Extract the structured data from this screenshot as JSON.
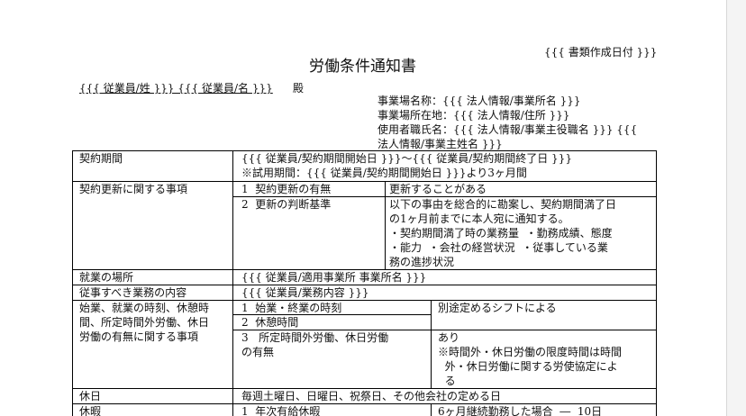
{
  "header": {
    "date": "{{{ 書類作成日付 }}}",
    "title": "労働条件通知書",
    "employee_name": "{{{ 従業員/姓 }}}  {{{ 従業員/名 }}}",
    "honorific": "殿",
    "workplace_name": "事業場名称：{{{ 法人情報/事業所名 }}}",
    "workplace_address": "事業場所在地：{{{ 法人情報/住所  }}}",
    "employer_line1": "使用者職氏名：{{{ 法人情報/事業主役職名 }}} {{{",
    "employer_line2": "法人情報/事業主姓名 }}}"
  },
  "rows": {
    "contract_period": {
      "label": "契約期間",
      "line1": "{{{ 従業員/契約期間開始日 }}}～{{{ 従業員/契約期間終了日 }}}",
      "line2": "※試用期間：{{{ 従業員/契約期間開始日 }}}より3ヶ月間"
    },
    "renewal": {
      "label": "契約更新に関する事項",
      "item1_label": "1  契約更新の有無",
      "item1_value": "更新することがある",
      "item2_label": "2  更新の判断基準",
      "item2_value_lines": [
        "以下の事由を総合的に勘案し、契約期間満了日",
        "の1ヶ月前までに本人宛に通知する。",
        "・契約期間満了時の業務量  ・勤務成績、態度",
        "・能力  ・会社の経営状況  ・従事している業",
        "務の進捗状況"
      ]
    },
    "workplace": {
      "label": "就業の場所",
      "value": "{{{ 従業員/適用事業所 事業所名 }}}"
    },
    "duties": {
      "label": "従事すべき業務の内容",
      "value": "{{{ 従業員/業務内容 }}}"
    },
    "hours": {
      "label_lines": [
        "始業、就業の時刻、休憩時",
        "間、所定時間外労働、休日",
        "労働の有無に関する事項"
      ],
      "item1_label": "1  始業・終業の時刻",
      "item1_value": "別途定めるシフトによる",
      "item2_label": "2  休憩時間",
      "item3_label_lines": [
        "3   所定時間外労働、休日労働",
        "の有無"
      ],
      "item3_value_lines": [
        "あり",
        "※時間外・休日労働の限度時間は時間",
        "  外・休日労働に関する労使協定によ",
        "  る"
      ]
    },
    "holidays": {
      "label": "休日",
      "value": "毎週土曜日、日曜日、祝祭日、その他会社の定める日"
    },
    "leave": {
      "label": "休暇",
      "item1_label": "1  年次有給休暇",
      "item1_value": "6ヶ月継続勤務した場合  ―  10日"
    }
  }
}
